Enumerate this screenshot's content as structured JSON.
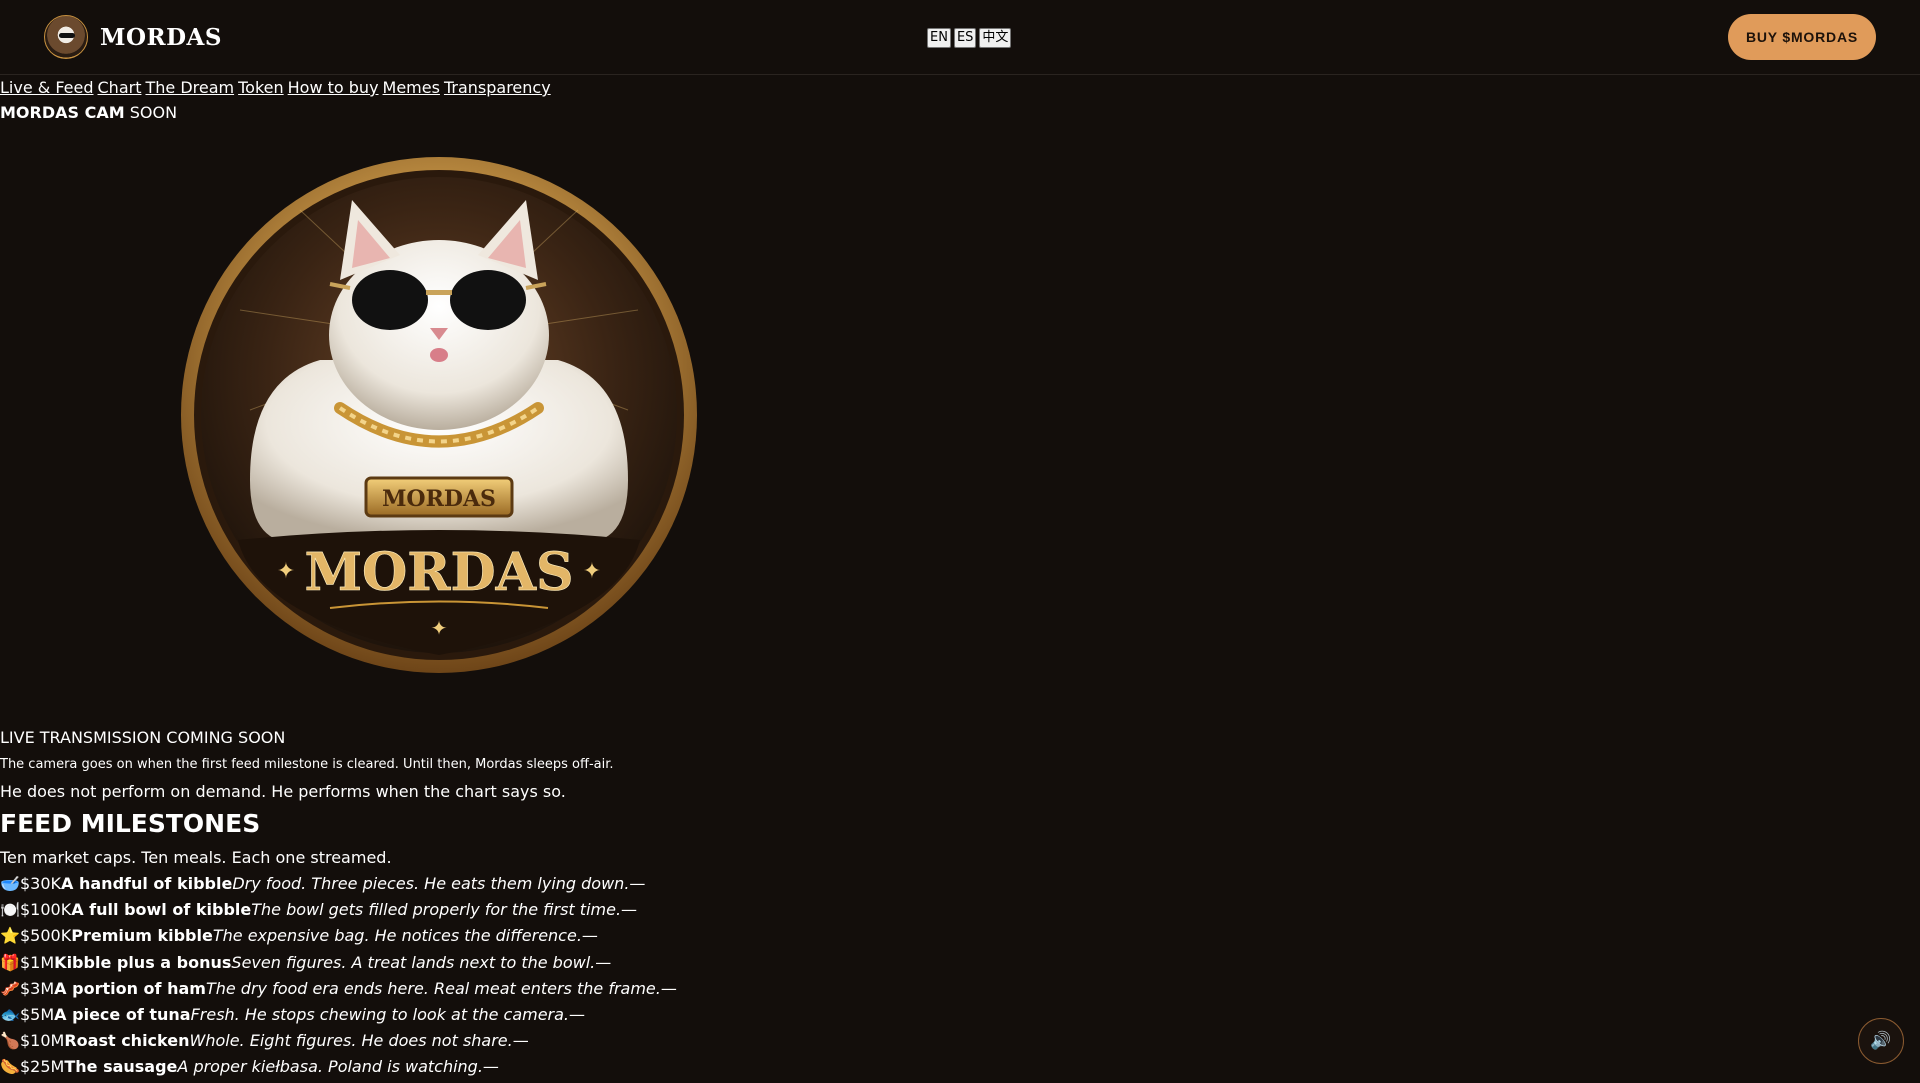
{
  "header": {
    "brand": "MORDAS",
    "languages": [
      "EN",
      "ES",
      "中文"
    ],
    "buy_label": "BUY $MORDAS"
  },
  "nav": {
    "links": [
      "Live & Feed",
      "Chart",
      "The Dream",
      "Token",
      "How to buy",
      "Memes",
      "Transparency"
    ]
  },
  "cam": {
    "title_bold": "MORDAS CAM",
    "title_rest": "SOON"
  },
  "coin": {
    "badge_text": "MORDAS",
    "main_text": "MORDAS"
  },
  "live": {
    "heading": "LIVE TRANSMISSION COMING SOON",
    "note": "The camera goes on when the first feed milestone is cleared. Until then, Mordas sleeps off-air.",
    "sub": "He does not perform on demand. He performs when the chart says so."
  },
  "feed": {
    "title": "FEED MILESTONES",
    "subtitle": "Ten market caps. Ten meals. Each one streamed.",
    "items": [
      {
        "icon": "🥣",
        "cap": "$30K",
        "name": "A handful of kibble",
        "desc": "Dry food. Three pieces. He eats them lying down.",
        "dash": "—"
      },
      {
        "icon": "🍽️",
        "cap": "$100K",
        "name": "A full bowl of kibble",
        "desc": "The bowl gets filled properly for the first time.",
        "dash": "—"
      },
      {
        "icon": "⭐",
        "cap": "$500K",
        "name": "Premium kibble",
        "desc": "The expensive bag. He notices the difference.",
        "dash": "—"
      },
      {
        "icon": "🎁",
        "cap": "$1M",
        "name": "Kibble plus a bonus",
        "desc": "Seven figures. A treat lands next to the bowl.",
        "dash": "—"
      },
      {
        "icon": "🥓",
        "cap": "$3M",
        "name": "A portion of ham",
        "desc": "The dry food era ends here. Real meat enters the frame.",
        "dash": "—"
      },
      {
        "icon": "🐟",
        "cap": "$5M",
        "name": "A piece of tuna",
        "desc": "Fresh. He stops chewing to look at the camera.",
        "dash": "—"
      },
      {
        "icon": "🍗",
        "cap": "$10M",
        "name": "Roast chicken",
        "desc": "Whole. Eight figures. He does not share.",
        "dash": "—"
      },
      {
        "icon": "🌭",
        "cap": "$25M",
        "name": "The sausage",
        "desc": "A proper kiełbasa. Poland is watching.",
        "dash": "—"
      }
    ]
  },
  "sound": {
    "icon": "🔊"
  },
  "colors": {
    "background": "#130e0b",
    "accent": "#e09b5a",
    "gold": "#d4a24e"
  }
}
